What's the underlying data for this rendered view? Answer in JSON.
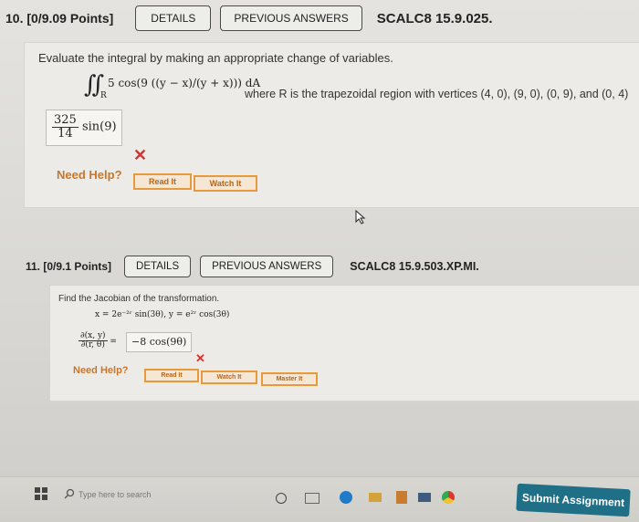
{
  "q10": {
    "number": "10. [0/9.09 Points]",
    "details": "DETAILS",
    "previous": "PREVIOUS ANSWERS",
    "code": "SCALC8 15.9.025.",
    "prompt": "Evaluate the integral by making an appropriate change of variables.",
    "integrand": "5 cos(9 ((y − x)/(y + x))) dA",
    "region_label": "R",
    "region_text": "where R is the trapezoidal region with vertices (4, 0), (9, 0), (0, 9), and (0, 4)",
    "answer_num": "325",
    "answer_den": "14",
    "answer_tail": "sin(9)",
    "need_help": "Need Help?",
    "read_it": "Read It",
    "watch_it": "Watch It"
  },
  "q11": {
    "number": "11. [0/9.1 Points]",
    "details": "DETAILS",
    "previous": "PREVIOUS ANSWERS",
    "code": "SCALC8 15.9.503.XP.MI.",
    "prompt": "Find the Jacobian of the transformation.",
    "transform": "x = 2e⁻²ʳ sin(3θ),   y = e²ʳ cos(3θ)",
    "jac_num": "∂(x, y)",
    "jac_den": "∂(r, θ)",
    "answer": "−8 cos(9θ)",
    "need_help": "Need Help?",
    "read_it": "Read It",
    "watch_it": "Watch It",
    "master_it": "Master It"
  },
  "taskbar": {
    "search_placeholder": "Type here to search",
    "submit": "Submit Assignment"
  },
  "colors": {
    "wrong": "#d8322f",
    "help": "#c9772a",
    "submit": "#1f6f86"
  }
}
